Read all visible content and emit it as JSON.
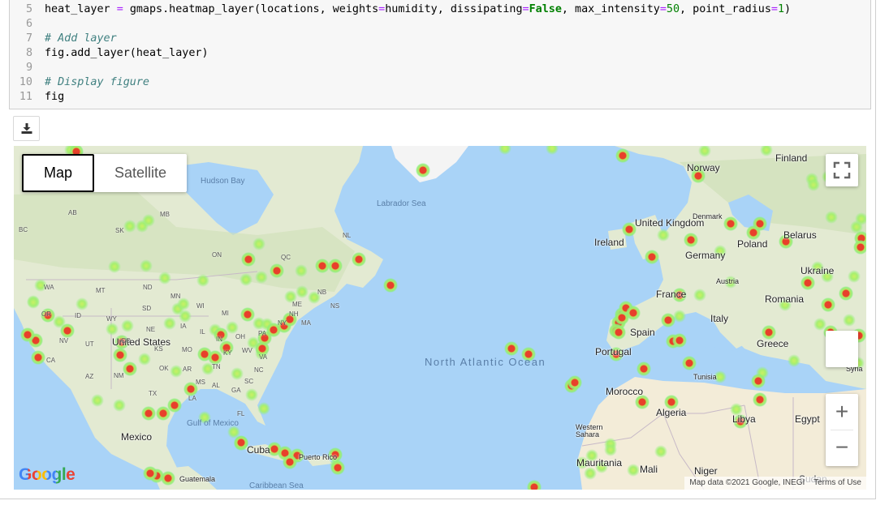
{
  "code": {
    "lines": [
      {
        "num": "5",
        "var": "heat_layer",
        "eq": "=",
        "call": "gmaps.heatmap_layer(locations, weights",
        "eq2": "=",
        "arg1": "humidity, dissipating",
        "eq3": "=",
        "kw": "False",
        "arg2": ", max_intensity",
        "eq4": "=",
        "v1": "50",
        "arg3": ", point_radius",
        "eq5": "=",
        "v2": "1",
        "end": ")"
      },
      {
        "num": "6"
      },
      {
        "num": "7",
        "comment": "# Add layer"
      },
      {
        "num": "8",
        "text": "fig.add_layer(heat_layer)"
      },
      {
        "num": "9"
      },
      {
        "num": "10",
        "comment": "# Display figure"
      },
      {
        "num": "11",
        "text": "fig"
      }
    ]
  },
  "toolbar": {
    "download_icon": "download-icon"
  },
  "map": {
    "map_type": {
      "map": "Map",
      "satellite": "Satellite"
    },
    "logo": "Google",
    "attribution": "Map data ©2021 Google, INEGI",
    "terms": "Terms of Use",
    "zoom_in": "+",
    "zoom_out": "−",
    "countries": [
      "Finland",
      "Norway",
      "Denmark",
      "United Kingdom",
      "Ireland",
      "Belarus",
      "Poland",
      "Germany",
      "Ukraine",
      "Austria",
      "France",
      "Romania",
      "Italy",
      "Spain",
      "Portugal",
      "Greece",
      "Syria",
      "Tunisia",
      "Morocco",
      "Algeria",
      "Libya",
      "Egypt",
      "Western Sahara",
      "Mauritania",
      "Mali",
      "Niger",
      "Sudan",
      "United States",
      "Mexico",
      "Cuba",
      "Puerto Rico",
      "Guatemala"
    ],
    "states": [
      "AB",
      "SK",
      "MB",
      "BC",
      "ON",
      "QC",
      "NL",
      "NB",
      "NS",
      "ME",
      "NH",
      "MA",
      "WA",
      "MT",
      "ND",
      "MN",
      "WI",
      "MI",
      "SD",
      "OR",
      "ID",
      "WY",
      "NE",
      "IA",
      "IL",
      "IN",
      "OH",
      "PA",
      "NY",
      "NV",
      "UT",
      "CO",
      "KS",
      "MO",
      "KY",
      "WV",
      "VA",
      "CA",
      "AZ",
      "NM",
      "OK",
      "AR",
      "TN",
      "NC",
      "MS",
      "AL",
      "GA",
      "SC",
      "TX",
      "LA",
      "FL"
    ],
    "water": {
      "hudson": "Hudson Bay",
      "labrador": "Labrador Sea",
      "north_atlantic": "North Atlantic Ocean",
      "gulf": "Gulf of Mexico",
      "caribbean": "Caribbean Sea"
    },
    "colors": {
      "water": "#a9d3f7",
      "land": "#e7ecd9",
      "heat_outer": "#8cf07a",
      "heat_inner": "#e8402b"
    }
  }
}
